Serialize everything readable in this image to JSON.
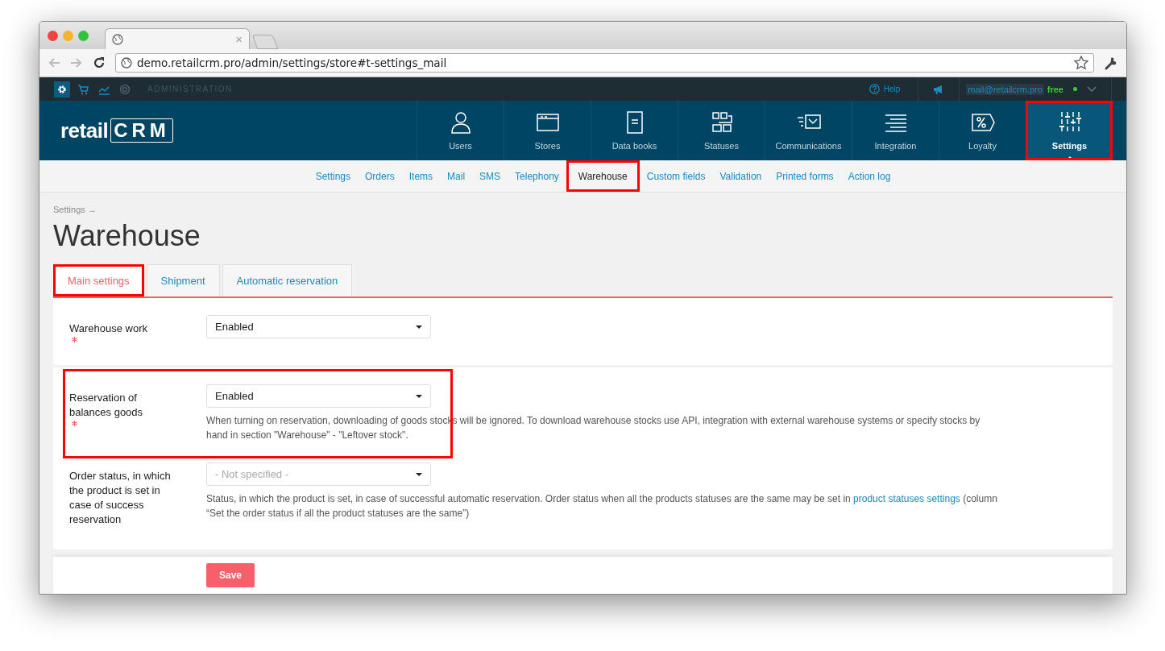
{
  "browser": {
    "tab_close": "×",
    "url": "demo.retailcrm.pro/admin/settings/store#t-settings_mail"
  },
  "admin_bar": {
    "icons": [
      {
        "kind": "gear",
        "selected": true
      },
      {
        "kind": "cart",
        "selected": false
      },
      {
        "kind": "chart",
        "selected": false
      },
      {
        "kind": "target",
        "selected": false
      }
    ],
    "label": "ADMINISTRATION",
    "help": "Help",
    "email": "mail@retailcrm.pro",
    "plan": "free"
  },
  "logo": {
    "text": "retail",
    "mark": "CRM"
  },
  "nav": [
    {
      "kind": "users",
      "label": "Users",
      "selected": false,
      "highlighted": false
    },
    {
      "kind": "stores",
      "label": "Stores",
      "selected": false,
      "highlighted": false
    },
    {
      "kind": "books",
      "label": "Data books",
      "selected": false,
      "highlighted": false
    },
    {
      "kind": "statuses",
      "label": "Statuses",
      "selected": false,
      "highlighted": false
    },
    {
      "kind": "comms",
      "label": "Communications",
      "selected": false,
      "highlighted": false
    },
    {
      "kind": "integration",
      "label": "Integration",
      "selected": false,
      "highlighted": false
    },
    {
      "kind": "loyalty",
      "label": "Loyalty",
      "selected": false,
      "highlighted": false
    },
    {
      "kind": "settings",
      "label": "Settings",
      "selected": true,
      "highlighted": true
    }
  ],
  "subnav": [
    {
      "label": "Settings",
      "selected": false,
      "highlighted": false
    },
    {
      "label": "Orders",
      "selected": false,
      "highlighted": false
    },
    {
      "label": "Items",
      "selected": false,
      "highlighted": false
    },
    {
      "label": "Mail",
      "selected": false,
      "highlighted": false
    },
    {
      "label": "SMS",
      "selected": false,
      "highlighted": false
    },
    {
      "label": "Telephony",
      "selected": false,
      "highlighted": false
    },
    {
      "label": "Warehouse",
      "selected": true,
      "highlighted": true
    },
    {
      "label": "Custom fields",
      "selected": false,
      "highlighted": false
    },
    {
      "label": "Validation",
      "selected": false,
      "highlighted": false
    },
    {
      "label": "Printed forms",
      "selected": false,
      "highlighted": false
    },
    {
      "label": "Action log",
      "selected": false,
      "highlighted": false
    }
  ],
  "breadcrumb": "Settings →",
  "title": "Warehouse",
  "tabs": [
    {
      "label": "Main settings",
      "selected": true,
      "highlighted": true
    },
    {
      "label": "Shipment",
      "selected": false,
      "highlighted": false
    },
    {
      "label": "Automatic reservation",
      "selected": false,
      "highlighted": false
    }
  ],
  "cards": [
    {
      "fields": [
        {
          "label": "Warehouse work",
          "required": true,
          "value": "Enabled",
          "placeholder_shown": false,
          "highlighted": false
        }
      ]
    },
    {
      "fields": [
        {
          "label": "Reservation of balances goods",
          "required": true,
          "value": "Enabled",
          "placeholder_shown": false,
          "highlighted": true,
          "help": [
            {
              "kind": "text",
              "text": "When turning on reservation, downloading of goods stocks will be ignored. To download warehouse stocks use API, integration with external warehouse systems or specify stocks by hand in section \"Warehouse\" - \"Leftover stock\"."
            }
          ]
        },
        {
          "label": "Order status, in which the product is set in case of success reservation",
          "required": false,
          "value": "- Not specified -",
          "placeholder_shown": true,
          "highlighted": false,
          "help": [
            {
              "kind": "text",
              "text": "Status, in which the product is set, in case of successful automatic reservation. Order status when all the products statuses are the same may be set in "
            },
            {
              "kind": "link",
              "text": "product statuses settings"
            },
            {
              "kind": "text",
              "text": " (column “Set the order status if all the product statuses are the same”)"
            }
          ]
        }
      ]
    }
  ],
  "save": "Save"
}
